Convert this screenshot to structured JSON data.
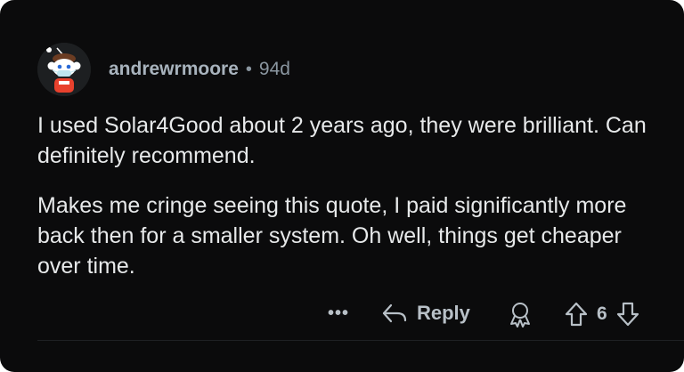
{
  "comment": {
    "username": "andrewrmoore",
    "separator": "•",
    "age": "94d",
    "paragraphs": [
      "I used Solar4Good about 2 years ago, they were brilliant. Can definitely recommend.",
      "Makes me cringe seeing this quote, I paid significantly more back then for a smaller system. Oh well, things get cheaper over time."
    ]
  },
  "actions": {
    "more_label": "•••",
    "reply_label": "Reply",
    "score": "6"
  },
  "colors": {
    "card_background": "#0b0b0c",
    "username": "#a8b3bd",
    "body_text": "#e7e9ea",
    "action_icons": "#b8c0c7"
  },
  "icons": [
    "snoo-avatar",
    "reply-arrow-icon",
    "award-icon",
    "upvote-icon",
    "downvote-icon"
  ]
}
